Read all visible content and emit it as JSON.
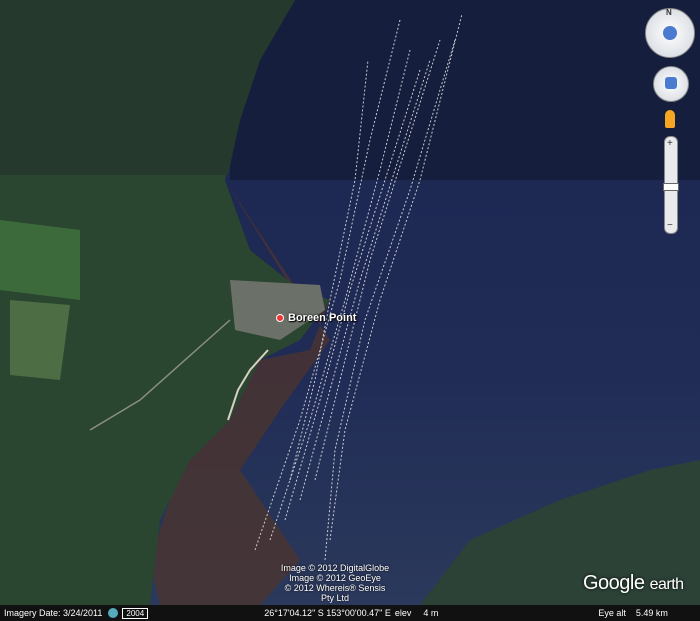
{
  "place": {
    "label": "Boreen Point"
  },
  "credits": [
    "Image © 2012 DigitalGlobe",
    "Image © 2012 GeoEye",
    "© 2012 Whereis® Sensis Pty Ltd"
  ],
  "brand": {
    "google": "Google",
    "earth": "earth"
  },
  "status": {
    "imagery_date": "Imagery Date: 3/24/2011",
    "year": "2004",
    "coords": "26°17'04.12\" S 153°00'00.47\" E",
    "elev_label": "elev",
    "elev_value": "4 m",
    "eye_alt_label": "Eye alt",
    "eye_alt_value": "5.49 km"
  },
  "controls": {
    "north_label": "N"
  },
  "colors": {
    "water": "#1e2a4d",
    "land": "#2f4a32",
    "shore_mud": "#5a3b2e",
    "track": "#e8e8e8"
  }
}
